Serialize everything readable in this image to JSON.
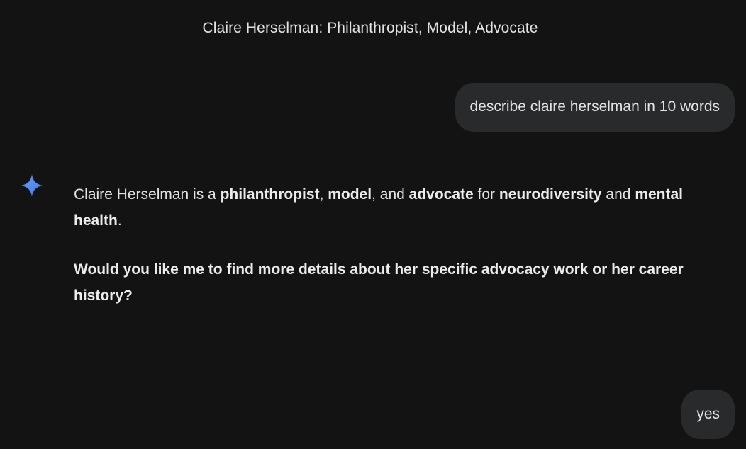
{
  "conversation": {
    "title": "Claire Herselman: Philanthropist, Model, Advocate"
  },
  "messages": {
    "user_1": "describe claire herselman in 10 words",
    "response": {
      "t1": "Claire Herselman is a ",
      "b1": "philanthropist",
      "t2": ", ",
      "b2": "model",
      "t3": ", and ",
      "b3": "advocate",
      "t4": " for ",
      "b4": "neurodiversity",
      "t5": " and ",
      "b5": "mental health",
      "t6": ".",
      "followup": "Would you like me to find more details about her specific advocacy work or her career history?"
    },
    "user_2": "yes"
  },
  "icons": {
    "assistant": "sparkle-icon"
  },
  "colors": {
    "background": "#131314",
    "user_bubble": "#282a2c",
    "text": "#e3e3e3",
    "divider": "#444746",
    "sparkle_blue": "#4f8df7"
  }
}
